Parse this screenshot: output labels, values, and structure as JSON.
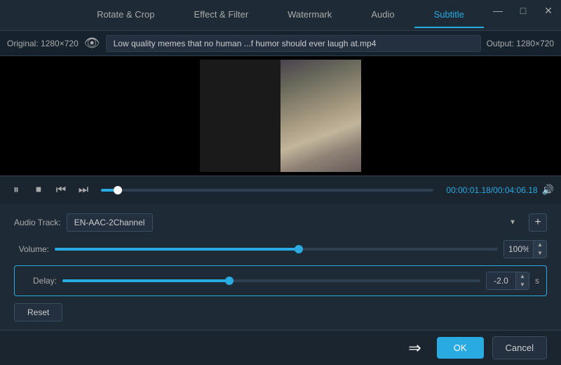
{
  "tabs": [
    {
      "id": "rotate",
      "label": "Rotate & Crop",
      "active": false
    },
    {
      "id": "effect",
      "label": "Effect & Filter",
      "active": false
    },
    {
      "id": "watermark",
      "label": "Watermark",
      "active": false
    },
    {
      "id": "audio",
      "label": "Audio",
      "active": false
    },
    {
      "id": "subtitle",
      "label": "Subtitle",
      "active": true
    }
  ],
  "winControls": {
    "minimize": "—",
    "maximize": "□",
    "close": "✕"
  },
  "fileBar": {
    "original": "Original: 1280×720",
    "filename": "Low quality memes that no human ...f humor should ever laugh at.mp4",
    "output": "Output: 1280×720"
  },
  "playback": {
    "time_current": "00:00:01.18",
    "time_total": "00:04:06.18",
    "time_separator": "/",
    "progress_percent": 5
  },
  "audio": {
    "track_label": "Audio Track:",
    "track_value": "EN-AAC-2Channel",
    "volume_label": "Volume:",
    "volume_percent": "100%",
    "volume_slider_percent": 55,
    "delay_label": "Delay:",
    "delay_value": "-2.0",
    "delay_slider_percent": 40,
    "delay_unit": "s"
  },
  "buttons": {
    "reset": "Reset",
    "ok": "OK",
    "cancel": "Cancel"
  },
  "icons": {
    "play_pause": "⏸",
    "stop": "⏹",
    "prev": "⏮",
    "next": "⏭",
    "volume": "🔊",
    "eye": "👁",
    "add": "+",
    "arrow": "→"
  }
}
